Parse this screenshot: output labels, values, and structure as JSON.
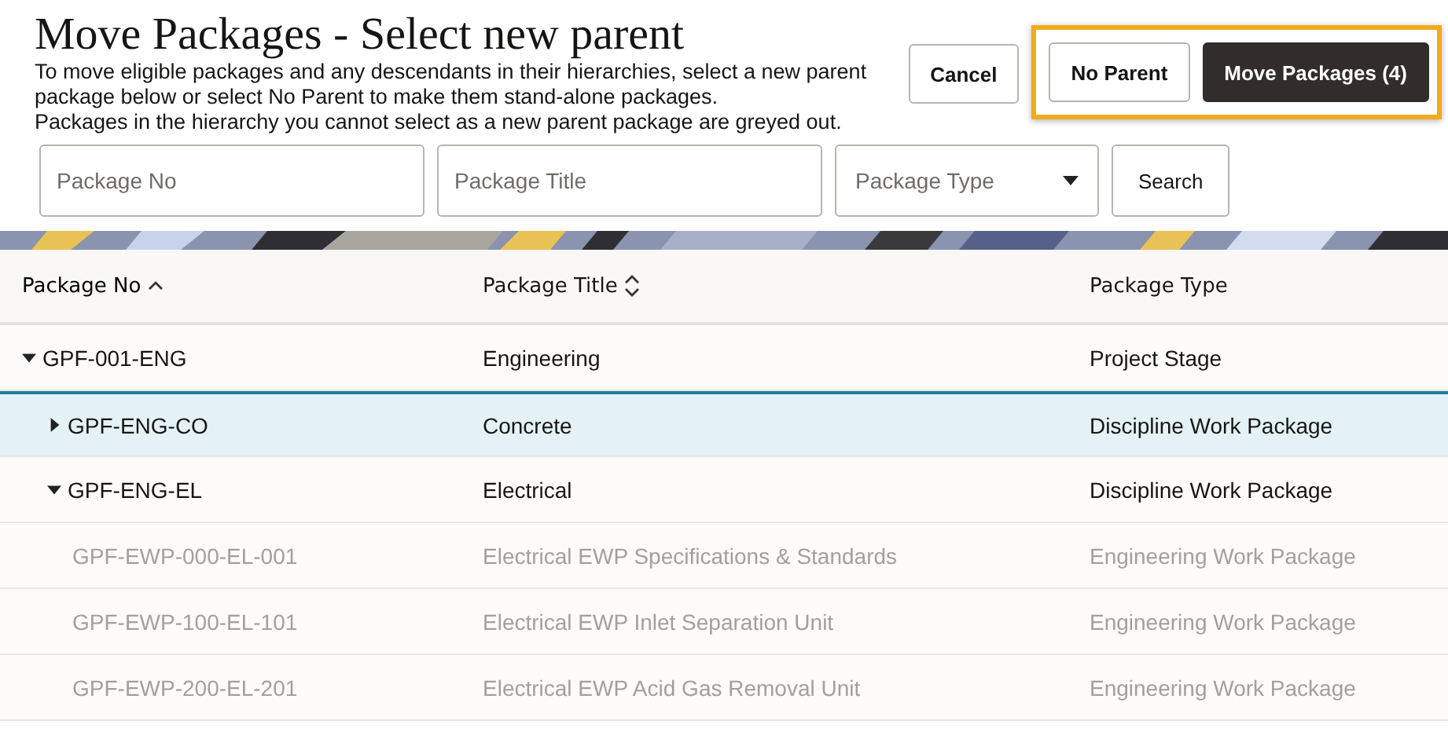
{
  "title": "Move Packages - Select new parent",
  "description": [
    "To move eligible packages and any descendants in their hierarchies, select a new parent package below or select No Parent to make them stand-alone packages.",
    "Packages in the hierarchy you cannot select as a new parent package are greyed out."
  ],
  "buttons": [
    {
      "label": "Cancel",
      "kind": "secondary",
      "highlighted": false
    },
    {
      "label": "No Parent",
      "kind": "secondary",
      "highlighted": true
    },
    {
      "label": "Move Packages (4)",
      "kind": "primary",
      "highlighted": true
    }
  ],
  "filters": [
    {
      "placeholder": "Package No",
      "kind": "text"
    },
    {
      "placeholder": "Package Title",
      "kind": "text"
    },
    {
      "placeholder": "Package Type",
      "kind": "select"
    }
  ],
  "search_button": "Search",
  "table": {
    "columns": [
      {
        "label": "Package No",
        "sortable": true,
        "sorted": true
      },
      {
        "label": "Package Title",
        "sortable": true,
        "sorted": false
      },
      {
        "label": "Package Type"
      }
    ],
    "rows": [
      {
        "cells": [
          "GPF-001-ENG",
          "Engineering",
          "Project Stage"
        ],
        "expanded": true,
        "selected": false,
        "disabled": false,
        "children": [
          {
            "cells": [
              "GPF-ENG-CO",
              "Concrete",
              "Discipline Work Package"
            ],
            "expanded": false,
            "selected": true,
            "disabled": false
          },
          {
            "cells": [
              "GPF-ENG-EL",
              "Electrical",
              "Discipline Work Package"
            ],
            "expanded": true,
            "selected": false,
            "disabled": false,
            "children": [
              {
                "cells": [
                  "GPF-EWP-000-EL-001",
                  "Electrical EWP Specifications & Standards",
                  "Engineering Work Package"
                ],
                "selected": false,
                "disabled": true
              },
              {
                "cells": [
                  "GPF-EWP-100-EL-101",
                  "Electrical EWP Inlet Separation Unit",
                  "Engineering Work Package"
                ],
                "selected": false,
                "disabled": true
              },
              {
                "cells": [
                  "GPF-EWP-200-EL-201",
                  "Electrical EWP Acid Gas Removal Unit",
                  "Engineering Work Package"
                ],
                "selected": false,
                "disabled": true
              }
            ]
          }
        ]
      }
    ]
  }
}
